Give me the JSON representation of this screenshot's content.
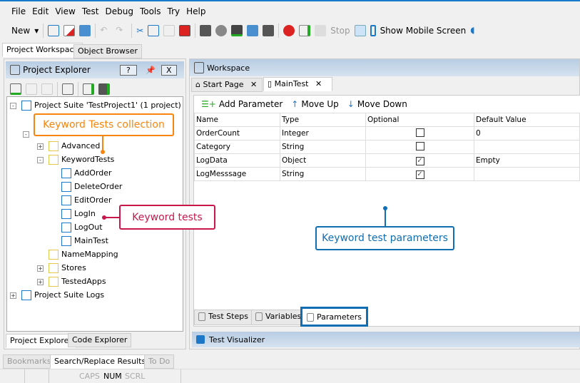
{
  "menu": [
    "File",
    "Edit",
    "View",
    "Test",
    "Debug",
    "Tools",
    "Try",
    "Help"
  ],
  "toolbar": {
    "new": "New",
    "stop": "Stop",
    "show_mobile": "Show Mobile Screen"
  },
  "workspace_tabs": [
    "Project Workspace",
    "Object Browser"
  ],
  "explorer": {
    "title": "Project Explorer",
    "help": "?",
    "close": "X",
    "tree": [
      {
        "label": "Project Suite 'TestProject1' (1 project)",
        "level": 0,
        "exp": "-"
      },
      {
        "label": "Advanced",
        "level": 2,
        "exp": "+"
      },
      {
        "label": "KeywordTests",
        "level": 2,
        "exp": "-"
      },
      {
        "label": "AddOrder",
        "level": 3
      },
      {
        "label": "DeleteOrder",
        "level": 3
      },
      {
        "label": "EditOrder",
        "level": 3
      },
      {
        "label": "LogIn",
        "level": 3
      },
      {
        "label": "LogOut",
        "level": 3
      },
      {
        "label": "MainTest",
        "level": 3
      },
      {
        "label": "NameMapping",
        "level": 2
      },
      {
        "label": "Stores",
        "level": 2,
        "exp": "+"
      },
      {
        "label": "TestedApps",
        "level": 2,
        "exp": "+"
      },
      {
        "label": "Project Suite Logs",
        "level": 0,
        "exp": "+"
      }
    ],
    "bottom_tabs": [
      "Project Explorer",
      "Code Explorer"
    ]
  },
  "workspace": {
    "title": "Workspace",
    "tabs": [
      "Start Page",
      "MainTest"
    ],
    "param_toolbar": {
      "add": "Add Parameter",
      "up": "Move Up",
      "down": "Move Down"
    },
    "columns": [
      "Name",
      "Type",
      "Optional",
      "Default Value"
    ],
    "rows": [
      {
        "name": "OrderCount",
        "type": "Integer",
        "optional": false,
        "default": "0"
      },
      {
        "name": "Category",
        "type": "String",
        "optional": false,
        "default": ""
      },
      {
        "name": "LogData",
        "type": "Object",
        "optional": true,
        "default": "Empty"
      },
      {
        "name": "LogMesssage",
        "type": "String",
        "optional": true,
        "default": ""
      }
    ],
    "bottom_tabs": [
      "Test Steps",
      "Variables",
      "Parameters"
    ],
    "visualizer": "Test Visualizer"
  },
  "callouts": {
    "collection": "Keyword Tests collection",
    "tests": "Keyword tests",
    "params": "Keyword test parameters"
  },
  "bottom_tabs": [
    "Bookmarks",
    "Search/Replace Results",
    "To Do"
  ],
  "status": [
    "CAPS",
    "NUM",
    "SCRL"
  ],
  "colors": {
    "orange": "#f7850f",
    "red": "#c8174b",
    "blue": "#0f6eb4",
    "accent": "#1979ca"
  }
}
